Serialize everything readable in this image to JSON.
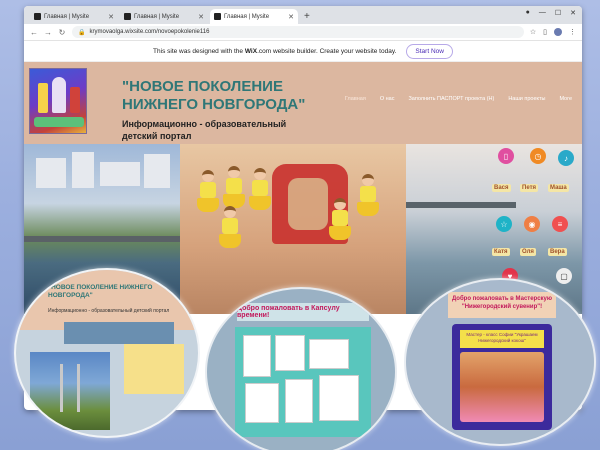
{
  "browser": {
    "tabs": [
      {
        "title": "Главная | Mysite",
        "active": false
      },
      {
        "title": "Главная | Mysite",
        "active": false
      },
      {
        "title": "Главная | Mysite",
        "active": true
      }
    ],
    "new_tab": "+",
    "url": "krymovaolga.wixsite.com/novoepokolenie116"
  },
  "wix_banner": {
    "text_before": "This site was designed with the",
    "brand": "WiX",
    "text_after": ".com website builder. Create your website today.",
    "cta": "Start Now"
  },
  "site": {
    "title": "\"НОВОЕ ПОКОЛЕНИЕ НИЖНЕГО НОВГОРОДА\"",
    "subtitle_line1": "Информационно - образовательный",
    "subtitle_line2": "детский портал",
    "nav": [
      "Главная",
      "О нас",
      "Заполнить ПАСПОРТ проекта (Н)",
      "Наши проекты",
      "More"
    ]
  },
  "apps": {
    "labels": [
      "Вася",
      "Петя",
      "Маша",
      "Катя",
      "Оля",
      "Вера"
    ]
  },
  "bubbles": {
    "left": {
      "title": "\"НОВОЕ ПОКОЛЕНИЕ НИЖНЕГО НОВГОРОДА\"",
      "subtitle": "Информационно - образовательный детский портал"
    },
    "middle": {
      "heading": "Добро пожаловать в Капсулу времени!"
    },
    "right": {
      "heading": "Добро пожаловать в Мастерскую \"Нижегородский сувенир\"!",
      "frame_label": "Мастер - класс Софии \"Украшаем Нижегородский кокош\""
    }
  }
}
